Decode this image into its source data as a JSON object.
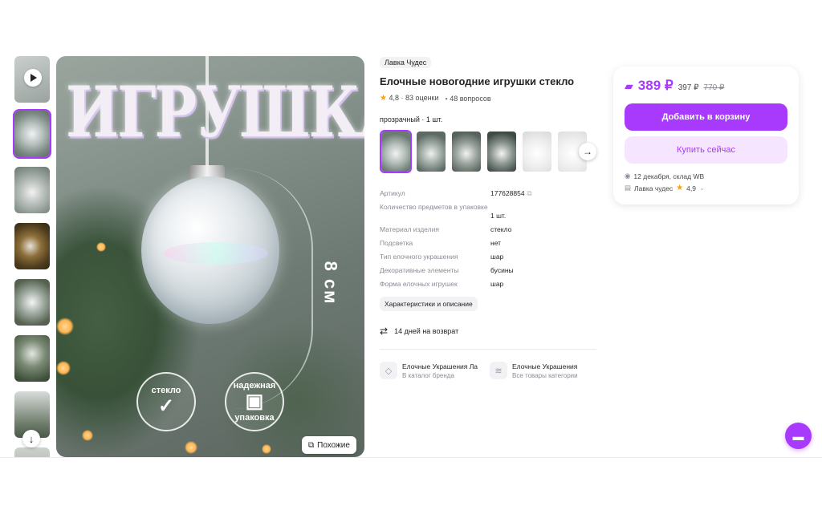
{
  "gallery": {
    "thumbnail_count": 8,
    "active_thumbnail_index": 1,
    "main_image": {
      "headline": "ИГРУШКА",
      "size_text": "8 см",
      "badge_1": "стекло",
      "badge_2_top": "надежная",
      "badge_2_bottom": "упаковка",
      "similar_label": "Похожие"
    }
  },
  "product": {
    "brand": "Лавка Чудес",
    "title": "Елочные новогодние игрушки стекло",
    "rating": "4,8",
    "ratings_count": "83 оценки",
    "questions": "48 вопросов",
    "variant_label": "прозрачный · 1 шт.",
    "variant_count": 6,
    "active_variant_index": 0
  },
  "specs": [
    {
      "key": "Артикул",
      "value": "177628854"
    },
    {
      "key": "Количество предметов в упаковке",
      "value": "1 шт."
    },
    {
      "key": "Материал изделия",
      "value": "стекло"
    },
    {
      "key": "Подсветка",
      "value": "нет"
    },
    {
      "key": "Тип елочного украшения",
      "value": "шар"
    },
    {
      "key": "Декоративные элементы",
      "value": "бусины"
    },
    {
      "key": "Форма елочных игрушек",
      "value": "шар"
    }
  ],
  "characteristics_button": "Характеристики и описание",
  "return_policy": "14 дней на возврат",
  "brand_links": [
    {
      "title": "Елочные Украшения Ла",
      "subtitle": "В каталог бренда"
    },
    {
      "title": "Елочные Украшения",
      "subtitle": "Все товары категории"
    }
  ],
  "price_card": {
    "price": "389 ₽",
    "price_mid": "397 ₽",
    "price_old": "770 ₽",
    "add_to_cart": "Добавить в корзину",
    "buy_now": "Купить сейчас",
    "delivery": "12 декабря, склад WB",
    "seller": "Лавка чудес",
    "seller_rating": "4,9"
  },
  "colors": {
    "accent": "#a73afd",
    "accent_light": "#f6e5ff",
    "star": "#ff9f00"
  }
}
